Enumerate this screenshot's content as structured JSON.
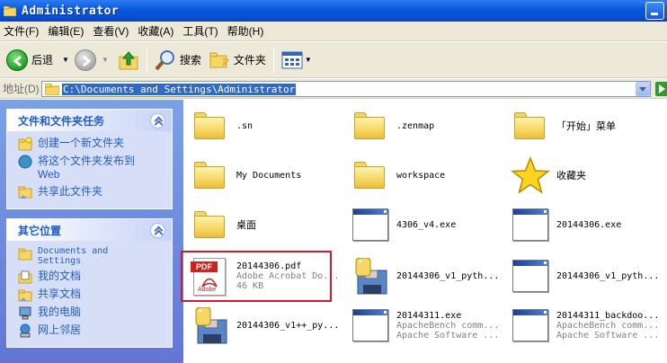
{
  "window": {
    "title": "Administrator"
  },
  "menu": [
    {
      "label": "文件(F)"
    },
    {
      "label": "编辑(E)"
    },
    {
      "label": "查看(V)"
    },
    {
      "label": "收藏(A)"
    },
    {
      "label": "工具(T)"
    },
    {
      "label": "帮助(H)"
    }
  ],
  "toolbar": {
    "back_label": "后退",
    "search_label": "搜索",
    "folders_label": "文件夹"
  },
  "address": {
    "label": "地址(D)",
    "path": "C:\\Documents and Settings\\Administrator"
  },
  "sidebar": {
    "tasks": {
      "title": "文件和文件夹任务",
      "items": [
        {
          "label": "创建一个新文件夹",
          "icon": "new-folder-icon"
        },
        {
          "label": "将这个文件夹发布到 Web",
          "icon": "publish-web-icon"
        },
        {
          "label": "共享此文件夹",
          "icon": "share-folder-icon"
        }
      ]
    },
    "places": {
      "title": "其它位置",
      "items": [
        {
          "label": "Documents and Settings",
          "icon": "folder-icon"
        },
        {
          "label": "我的文档",
          "icon": "my-documents-icon"
        },
        {
          "label": "共享文档",
          "icon": "shared-documents-icon"
        },
        {
          "label": "我的电脑",
          "icon": "my-computer-icon"
        },
        {
          "label": "网上邻居",
          "icon": "network-icon"
        }
      ]
    }
  },
  "files": [
    {
      "name": ".sn",
      "type": "folder"
    },
    {
      "name": ".zenmap",
      "type": "folder"
    },
    {
      "name": "「开始」菜单",
      "type": "folder"
    },
    {
      "name": "My Documents",
      "type": "folder"
    },
    {
      "name": "workspace",
      "type": "folder"
    },
    {
      "name": "收藏夹",
      "type": "favorites"
    },
    {
      "name": "桌面",
      "type": "folder"
    },
    {
      "name": "4306_v4.exe",
      "type": "exe"
    },
    {
      "name": "20144306.exe",
      "type": "exe"
    },
    {
      "name": "20144306.pdf",
      "type": "pdf",
      "sub1": "Adobe Acrobat Do...",
      "sub2": "46 KB"
    },
    {
      "name": "20144306_v1_pyth...",
      "type": "python"
    },
    {
      "name": "20144306_v1_pyth...",
      "type": "exe"
    },
    {
      "name": "20144306_v1++_py...",
      "type": "python"
    },
    {
      "name": "20144311.exe",
      "type": "exe",
      "sub1": "ApacheBench comm...",
      "sub2": "Apache Software ..."
    },
    {
      "name": "20144311_backdoo...",
      "type": "exe",
      "sub1": "ApacheBench comm...",
      "sub2": "Apache Software ..."
    }
  ],
  "colors": {
    "title_blue": "#0a4fd0",
    "task_blue": "#215dc6",
    "sidebar_bg": "#6f8fdd",
    "highlight_red": "#d3192a"
  }
}
